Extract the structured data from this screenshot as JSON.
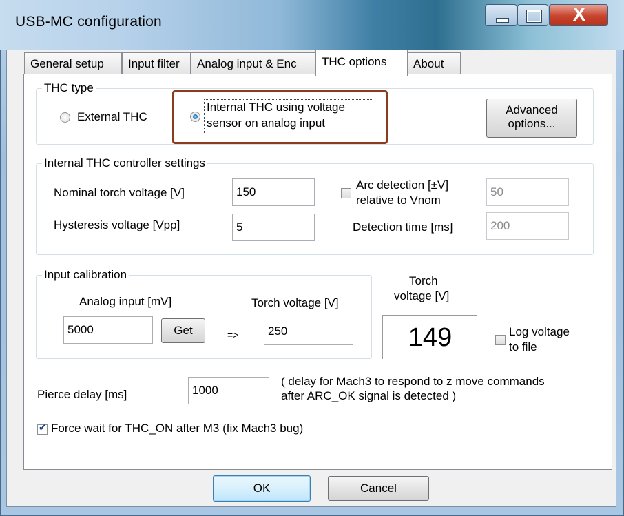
{
  "window": {
    "title": "USB-MC configuration"
  },
  "tabs": [
    {
      "label": "General setup"
    },
    {
      "label": "Input filter"
    },
    {
      "label": "Analog input & Enc"
    },
    {
      "label": "THC options"
    },
    {
      "label": "About"
    }
  ],
  "thc_type": {
    "group_label": "THC type",
    "external_label": "External THC",
    "internal_label_line1": "Internal THC using voltage",
    "internal_label_line2": "sensor on analog input",
    "selected": "internal",
    "advanced_line1": "Advanced",
    "advanced_line2": "options..."
  },
  "controller": {
    "group_label": "Internal THC controller settings",
    "nominal_label": "Nominal torch voltage [V]",
    "nominal_value": "150",
    "hysteresis_label": "Hysteresis voltage [Vpp]",
    "hysteresis_value": "5",
    "arc_label_line1": "Arc detection [±V]",
    "arc_label_line2": "relative to Vnom",
    "arc_checked": false,
    "arc_value": "50",
    "detection_label": "Detection time [ms]",
    "detection_value": "200"
  },
  "calibration": {
    "group_label": "Input calibration",
    "analog_label": "Analog input [mV]",
    "analog_value": "5000",
    "get_label": "Get",
    "arrow": "=>",
    "torch_label": "Torch voltage [V]",
    "torch_value": "250"
  },
  "readout": {
    "label_line1": "Torch",
    "label_line2": "voltage [V]",
    "value": "149",
    "log_label_line1": "Log voltage",
    "log_label_line2": "to file",
    "log_checked": false
  },
  "pierce": {
    "label": "Pierce delay [ms]",
    "value": "1000",
    "note_line1": "( delay for Mach3 to respond to z move commands",
    "note_line2": "after ARC_OK signal is detected )"
  },
  "force_wait": {
    "label": "Force wait for THC_ON after M3 (fix Mach3 bug)",
    "checked": true
  },
  "footer": {
    "ok_label": "OK",
    "cancel_label": "Cancel"
  }
}
